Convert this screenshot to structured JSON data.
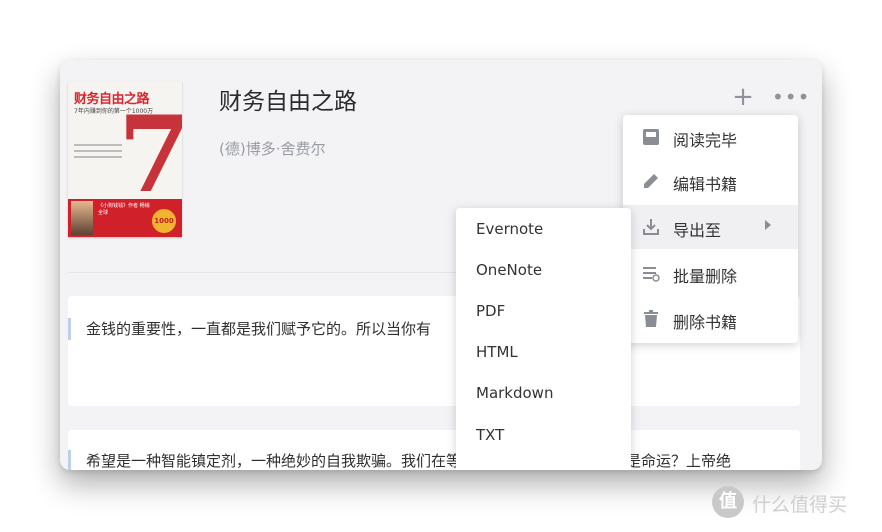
{
  "book": {
    "title": "财务自由之路",
    "author": "(德)博多·舍费尔",
    "cover": {
      "title": "财务自由之路",
      "subtitle": "7年内赚到你的第一个1000万",
      "badge": "1000",
      "strip_text": "《小狗钱钱》作者 畅销全球"
    }
  },
  "header_actions": {
    "add": "+",
    "more": "•••"
  },
  "menu": {
    "items": [
      {
        "label": "阅读完毕",
        "icon": "book-icon"
      },
      {
        "label": "编辑书籍",
        "icon": "pencil-icon"
      },
      {
        "label": "导出至",
        "icon": "download-icon",
        "has_submenu": true,
        "highlighted": true
      },
      {
        "label": "批量删除",
        "icon": "batch-list-icon"
      },
      {
        "label": "删除书籍",
        "icon": "trash-icon"
      }
    ]
  },
  "submenu": {
    "items": [
      "Evernote",
      "OneNote",
      "PDF",
      "HTML",
      "Markdown",
      "TXT"
    ]
  },
  "highlights": [
    {
      "text": "金钱的重要性，一直都是我们赋予它的。所以当你有"
    },
    {
      "text": "希望是一种智能镇定剂，一种绝妙的自我欺骗。我们在等谁？在等什么？是上帝还是命运？上帝绝"
    }
  ],
  "watermark": {
    "text": "什么值得买",
    "badge": "值"
  },
  "colors": {
    "window_bg": "#f3f3f6",
    "accent_bar": "#bcd0ec",
    "cover_red": "#d0202a"
  }
}
